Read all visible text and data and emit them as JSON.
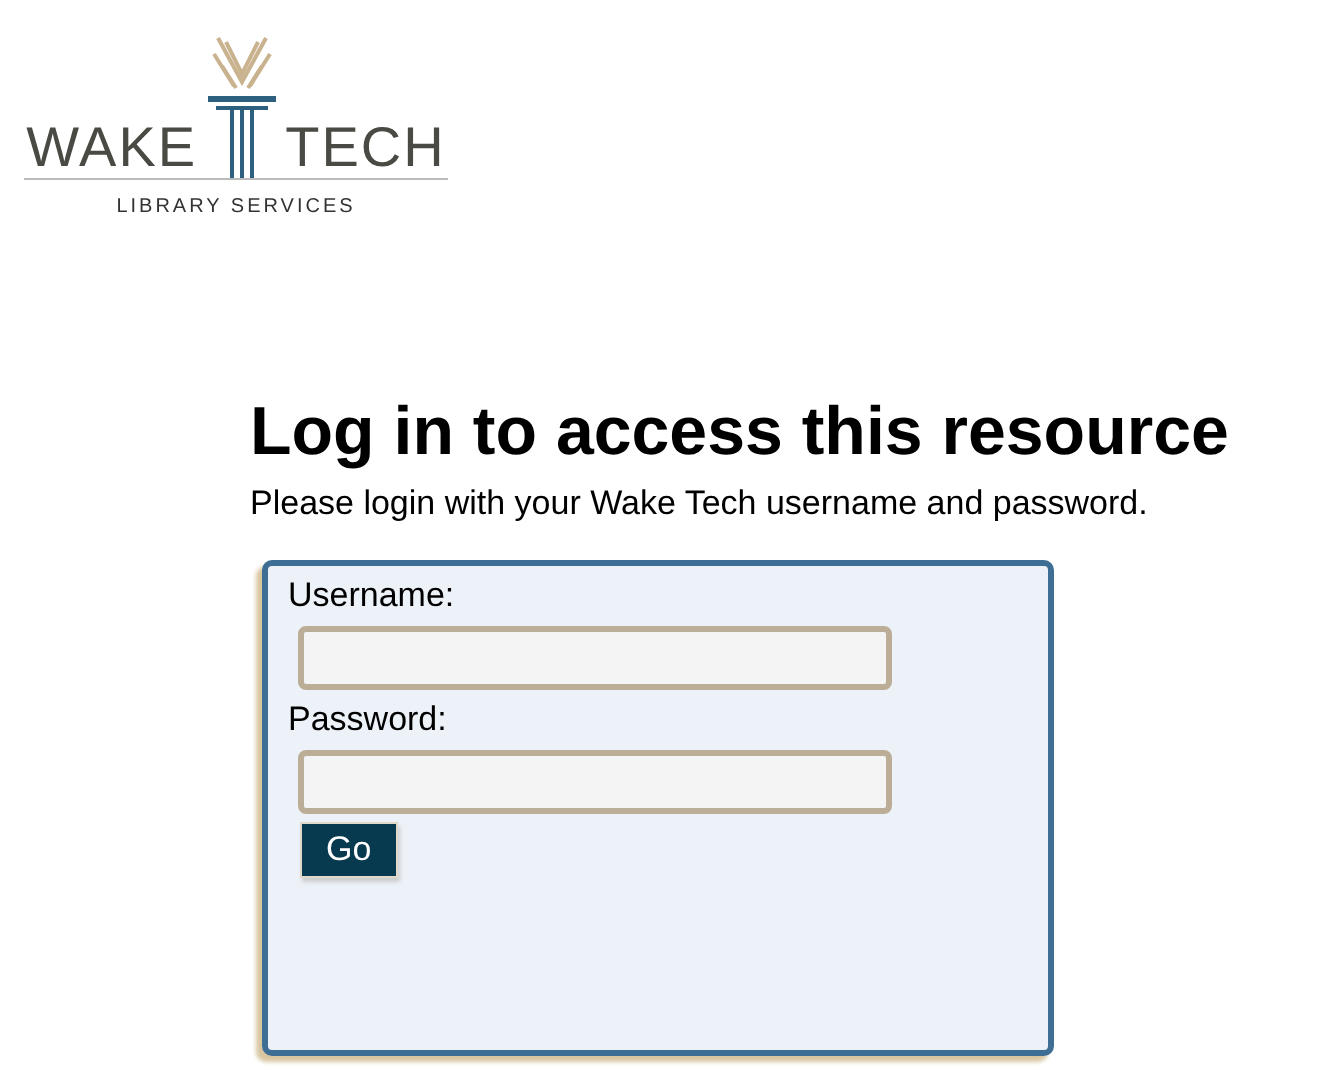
{
  "logo": {
    "name": "WAKE",
    "name_2": "TECH",
    "tagline": "LIBRARY SERVICES"
  },
  "heading": "Log in to access this resource",
  "intro": "Please login with your Wake Tech username and password.",
  "form": {
    "fields": [
      {
        "label": "Username:"
      },
      {
        "label": "Password:"
      }
    ],
    "button": "Go"
  }
}
